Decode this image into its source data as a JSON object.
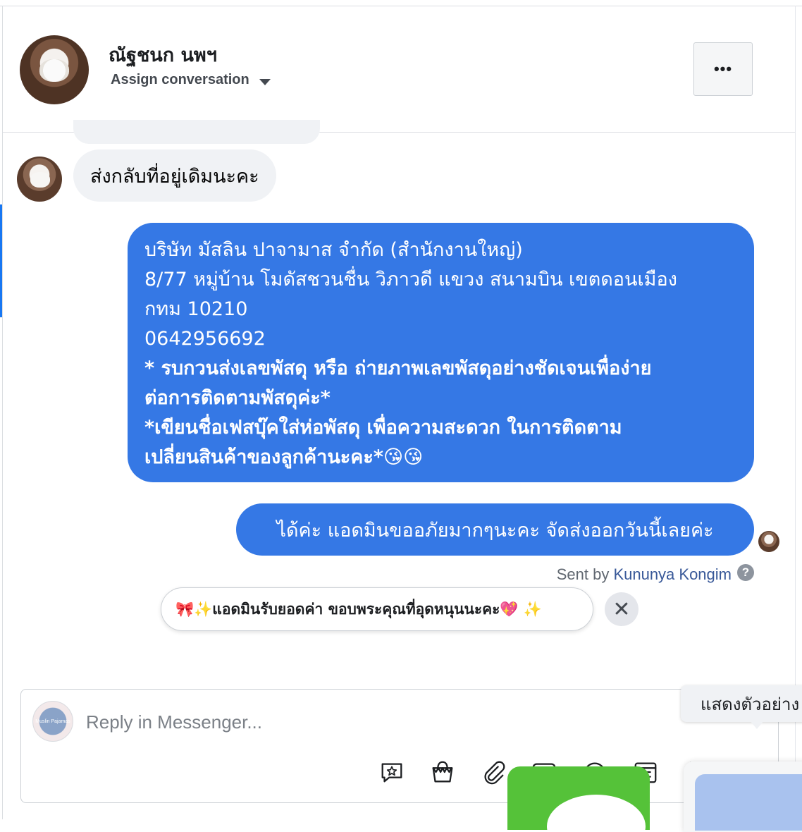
{
  "header": {
    "contact_name": "ณัฐชนก นพฯ",
    "assign_label": "Assign conversation",
    "more_label": "•••"
  },
  "messages": {
    "incoming_text": "ส่งกลับที่อยู่เดิมนะคะ",
    "outgoing_lines": [
      "บริษัท มัสลิน ปาจามาส จำกัด (สำนักงานใหญ่)",
      "8/77  หมู่บ้าน โมดัสชวนชื่น วิภาวดี แขวง สนามบิน เขตดอนเมือง",
      "กทม 10210",
      "0642956692",
      "* รบกวนส่งเลขพัสดุ หรือ ถ่ายภาพเลขพัสดุอย่างชัดเจนเพื่อง่าย",
      "ต่อการติดตามพัสดุค่ะ*",
      "*เขียนชื่อเฟสบุ๊คใส่ห่อพัสดุ  เพื่อความสะดวก ในการติดตาม",
      "เปลี่ยนสินค้าของลูกค้านะคะ*😘😘"
    ],
    "outgoing_short": "ได้ค่ะ แอดมินขออภัยมากๆนะคะ จัดส่งออกวันนี้เลยค่ะ",
    "sent_by_prefix": "Sent by ",
    "sent_by_name": "Kununya Kongim",
    "help_symbol": "?"
  },
  "suggestion": {
    "text": "🎀✨แอดมินรับยอดค่า ขอบพระคุณที่อุดหนุนนะคะ💖 ✨",
    "close_symbol": "✕"
  },
  "composer": {
    "placeholder": "Reply in Messenger...",
    "page_logo_text": "Muslin Pajamas",
    "tools": [
      "saved-reply-icon",
      "shop-bag-icon",
      "attachment-icon",
      "image-icon",
      "emoji-icon",
      "calendar-icon",
      "more-tools-icon"
    ]
  },
  "tooltip": {
    "text": "แสดงตัวอย่าง"
  },
  "colors": {
    "outgoing_bubble": "#3578e5",
    "incoming_bubble": "#f0f2f5",
    "link": "#385898"
  }
}
